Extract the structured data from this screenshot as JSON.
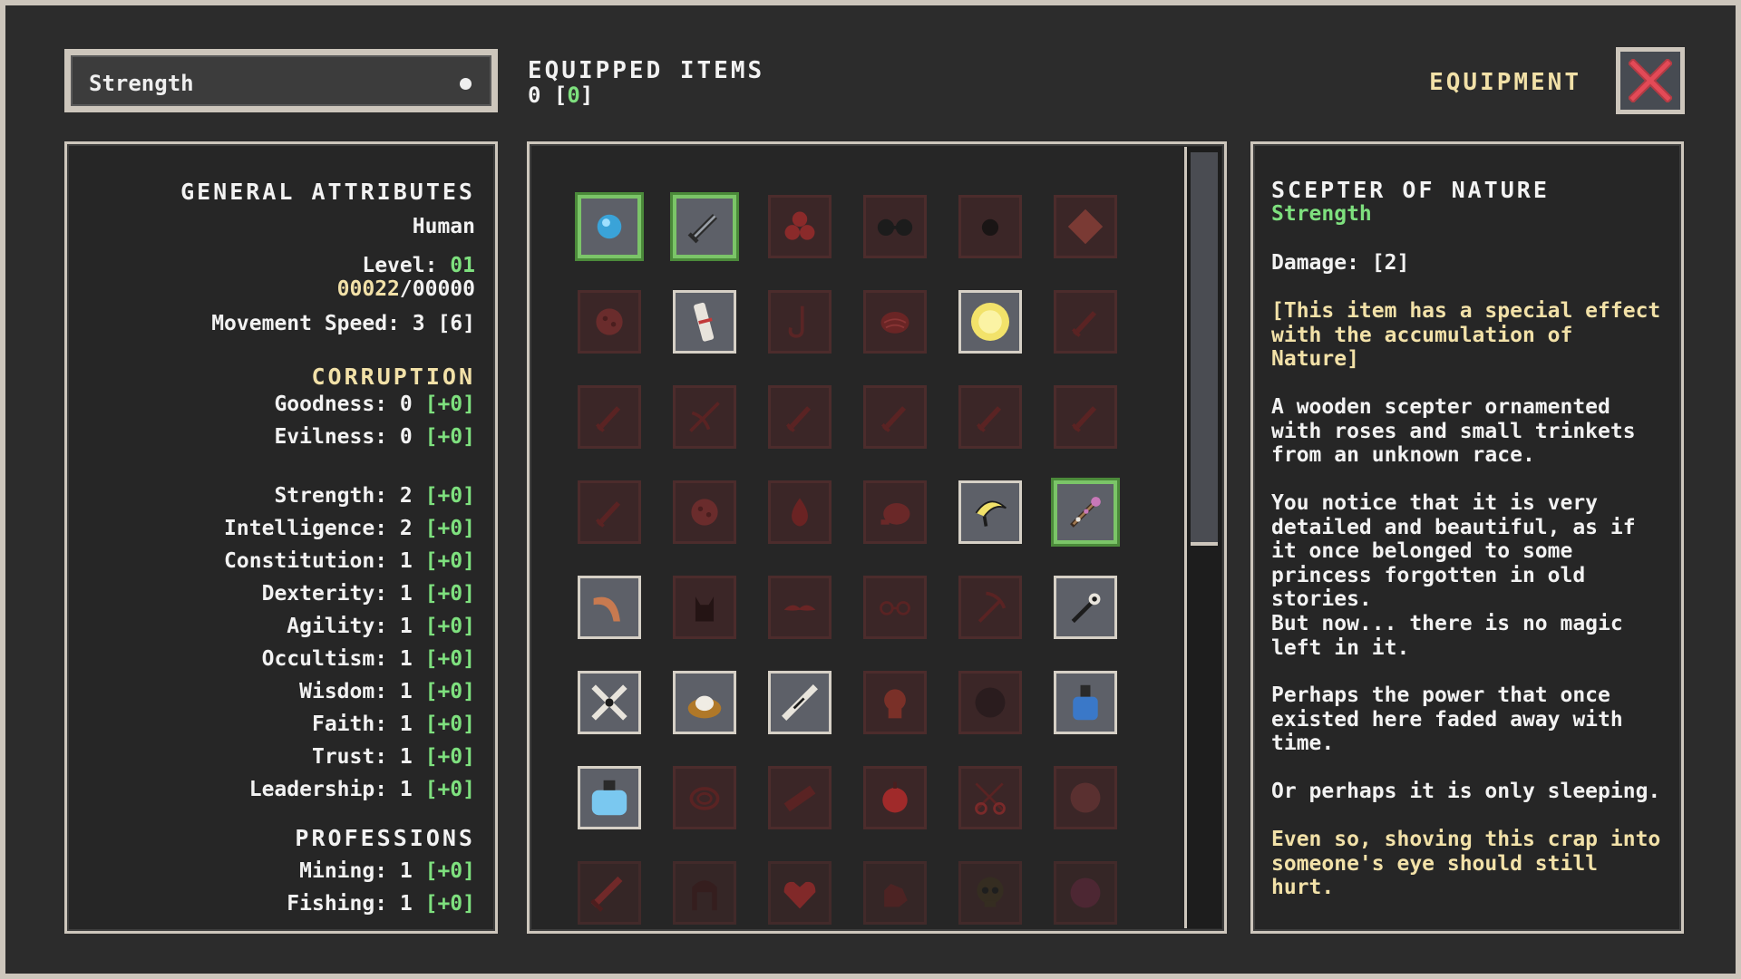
{
  "filter": {
    "selected": "Strength"
  },
  "equipped": {
    "title": "EQUIPPED ITEMS",
    "count": "0",
    "bonus": "0"
  },
  "window": {
    "title": "EQUIPMENT"
  },
  "attributes": {
    "general_title": "GENERAL ATTRIBUTES",
    "race": "Human",
    "level_label": "Level:",
    "level_value": "01",
    "xp_current": "00022",
    "xp_max": "/00000",
    "movement_label": "Movement Speed: 3 [6]",
    "corruption_title": "CORRUPTION",
    "corruption": [
      {
        "label": "Goodness: 0 ",
        "bonus": "[+0]"
      },
      {
        "label": "Evilness: 0 ",
        "bonus": "[+0]"
      }
    ],
    "stats": [
      {
        "label": "Strength: 2 ",
        "bonus": "[+0]"
      },
      {
        "label": "Intelligence: 2 ",
        "bonus": "[+0]"
      },
      {
        "label": "Constitution: 1 ",
        "bonus": "[+0]"
      },
      {
        "label": "Dexterity: 1 ",
        "bonus": "[+0]"
      },
      {
        "label": "Agility: 1 ",
        "bonus": "[+0]"
      },
      {
        "label": "Occultism: 1 ",
        "bonus": "[+0]"
      },
      {
        "label": "Wisdom: 1 ",
        "bonus": "[+0]"
      },
      {
        "label": "Faith: 1 ",
        "bonus": "[+0]"
      },
      {
        "label": "Trust: 1 ",
        "bonus": "[+0]"
      },
      {
        "label": "Leadership: 1 ",
        "bonus": "[+0]"
      }
    ],
    "professions_title": "PROFESSIONS",
    "professions": [
      {
        "label": "Mining: 1 ",
        "bonus": "[+0]"
      },
      {
        "label": "Fishing: 1 ",
        "bonus": "[+0]"
      }
    ]
  },
  "inventory": [
    {
      "icon": "blue-gem-icon",
      "state": "equipped"
    },
    {
      "icon": "sword-icon",
      "state": "equipped"
    },
    {
      "icon": "berries-icon",
      "state": "locked"
    },
    {
      "icon": "goggles-icon",
      "state": "locked"
    },
    {
      "icon": "dark-orb-icon",
      "state": "locked"
    },
    {
      "icon": "diamond-gem-icon",
      "state": "locked"
    },
    {
      "icon": "round-stone-icon",
      "state": "locked"
    },
    {
      "icon": "scroll-icon",
      "state": "active"
    },
    {
      "icon": "hook-icon",
      "state": "locked"
    },
    {
      "icon": "brain-icon",
      "state": "locked"
    },
    {
      "icon": "sun-orb-icon",
      "state": "active"
    },
    {
      "icon": "dagger-icon",
      "state": "locked"
    },
    {
      "icon": "dagger-icon",
      "state": "locked"
    },
    {
      "icon": "crossbow-icon",
      "state": "locked"
    },
    {
      "icon": "dagger-icon",
      "state": "locked"
    },
    {
      "icon": "dagger-icon",
      "state": "locked"
    },
    {
      "icon": "dagger-icon",
      "state": "locked"
    },
    {
      "icon": "dagger-icon",
      "state": "locked"
    },
    {
      "icon": "dagger-icon",
      "state": "locked"
    },
    {
      "icon": "round-stone-icon",
      "state": "locked"
    },
    {
      "icon": "drop-icon",
      "state": "locked"
    },
    {
      "icon": "meat-icon",
      "state": "locked"
    },
    {
      "icon": "sickle-icon",
      "state": "active"
    },
    {
      "icon": "scepter-icon",
      "state": "equipped"
    },
    {
      "icon": "boomerang-icon",
      "state": "active"
    },
    {
      "icon": "cat-icon",
      "state": "locked"
    },
    {
      "icon": "mustache-icon",
      "state": "locked"
    },
    {
      "icon": "glasses-icon",
      "state": "locked"
    },
    {
      "icon": "pickaxe-icon",
      "state": "locked"
    },
    {
      "icon": "wand-icon",
      "state": "active"
    },
    {
      "icon": "shuriken-icon",
      "state": "active"
    },
    {
      "icon": "nest-icon",
      "state": "active"
    },
    {
      "icon": "bone-knife-icon",
      "state": "active"
    },
    {
      "icon": "head-icon",
      "state": "locked"
    },
    {
      "icon": "dark-stone-icon",
      "state": "locked"
    },
    {
      "icon": "blue-bottle-icon",
      "state": "active"
    },
    {
      "icon": "blue-potion-icon",
      "state": "active"
    },
    {
      "icon": "rope-icon",
      "state": "locked"
    },
    {
      "icon": "log-icon",
      "state": "locked"
    },
    {
      "icon": "apple-icon",
      "state": "locked"
    },
    {
      "icon": "scissors-icon",
      "state": "locked"
    },
    {
      "icon": "wood-orb-icon",
      "state": "locked"
    },
    {
      "icon": "bloody-blade-icon",
      "state": "locked"
    },
    {
      "icon": "hair-icon",
      "state": "locked"
    },
    {
      "icon": "heart-icon",
      "state": "locked"
    },
    {
      "icon": "glove-icon",
      "state": "locked"
    },
    {
      "icon": "skull-icon",
      "state": "locked"
    },
    {
      "icon": "purple-orb-icon",
      "state": "locked"
    }
  ],
  "item": {
    "name": "SCEPTER OF NATURE",
    "type": "Strength",
    "damage": "Damage: [2]",
    "special": "[This item has a special effect with the accumulation of Nature]",
    "desc1": "A wooden scepter ornamented with roses and small trinkets from an unknown race.",
    "desc2": "You notice that it is very detailed and beautiful, as if it once belonged to some princess forgotten in old stories.",
    "desc3": "But now... there is no magic left in it.",
    "desc4": "Perhaps the power that once existed here faded away with time.",
    "desc5": "Or perhaps it is only sleeping.",
    "quote": "Even so, shoving this crap into someone's eye should still hurt."
  },
  "colors": {
    "accent": "#f2e1a8",
    "bonus": "#7ee07e",
    "equipped_border": "#7bc568",
    "background": "#2c2c2c"
  }
}
